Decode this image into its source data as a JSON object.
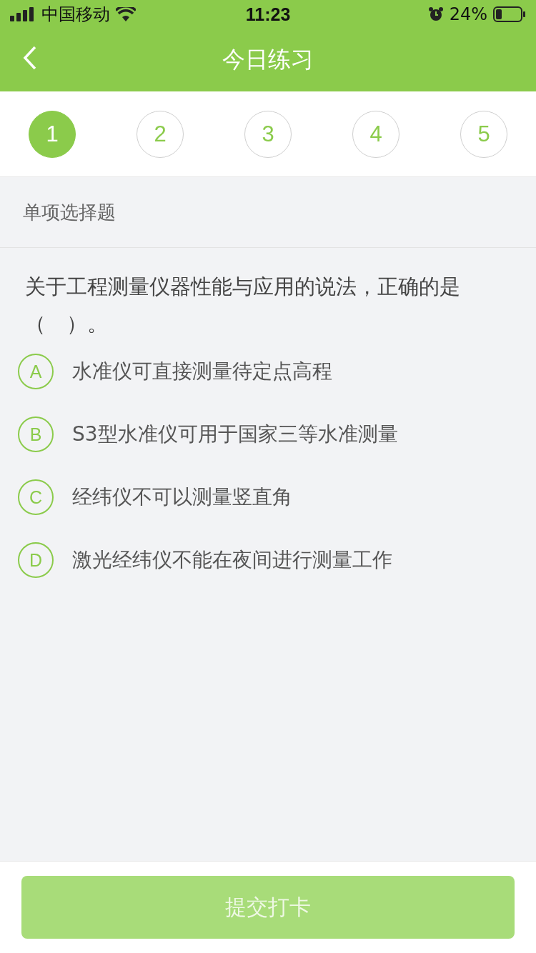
{
  "status_bar": {
    "carrier": "中国移动",
    "time": "11:23",
    "battery": "24%"
  },
  "nav": {
    "title": "今日练习"
  },
  "steps": [
    {
      "label": "1",
      "selected": true
    },
    {
      "label": "2",
      "selected": false
    },
    {
      "label": "3",
      "selected": false
    },
    {
      "label": "4",
      "selected": false
    },
    {
      "label": "5",
      "selected": false
    }
  ],
  "section": {
    "label": "单项选择题"
  },
  "question": {
    "text": "关于工程测量仪器性能与应用的说法，正确的是（　）。"
  },
  "options": [
    {
      "letter": "A",
      "text": "水准仪可直接测量待定点高程",
      "selected": false
    },
    {
      "letter": "B",
      "text": "S3型水准仪可用于国家三等水准测量",
      "selected": false
    },
    {
      "letter": "C",
      "text": "经纬仪不可以测量竖直角",
      "selected": false
    },
    {
      "letter": "D",
      "text": "激光经纬仪不能在夜间进行测量工作",
      "selected": false
    }
  ],
  "submit": {
    "label": "提交打卡",
    "disabled": true
  }
}
